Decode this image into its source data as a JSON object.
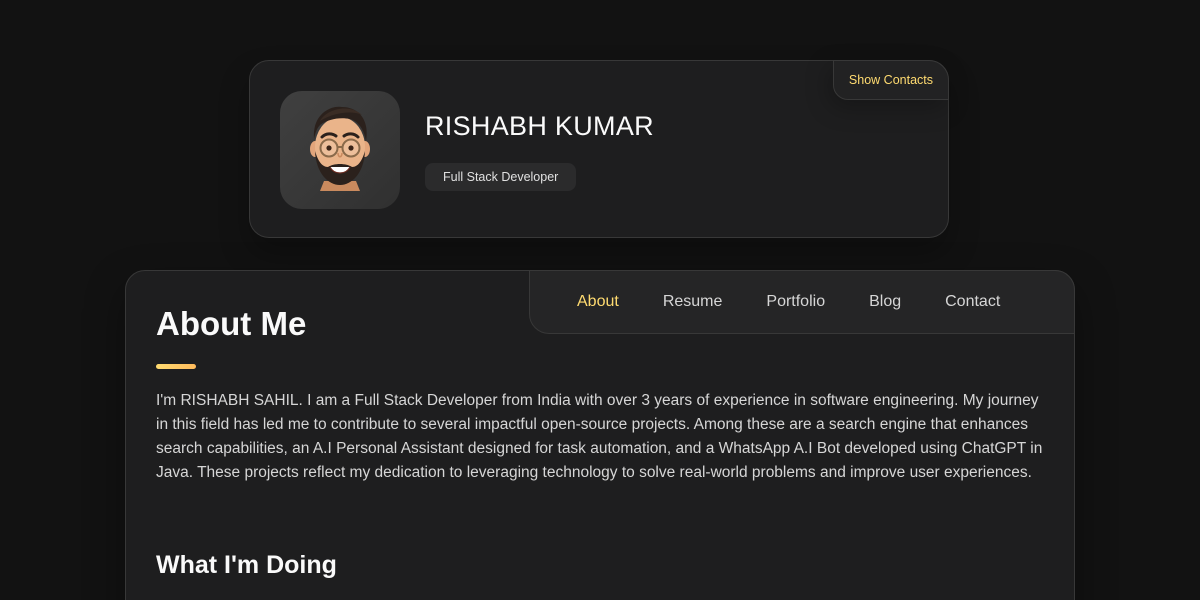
{
  "profile": {
    "name": "RISHABH KUMAR",
    "title": "Full Stack Developer",
    "show_contacts_label": "Show Contacts",
    "avatar_icon": "memoji-avatar-icon"
  },
  "navbar": {
    "items": [
      {
        "label": "About",
        "active": true
      },
      {
        "label": "Resume",
        "active": false
      },
      {
        "label": "Portfolio",
        "active": false
      },
      {
        "label": "Blog",
        "active": false
      },
      {
        "label": "Contact",
        "active": false
      }
    ]
  },
  "about": {
    "title": "About Me",
    "text": "I'm RISHABH SAHIL. I am a Full Stack Developer from India with over 3 years of experience in software engineering. My journey in this field has led me to contribute to several impactful open-source projects. Among these are a search engine that enhances search capabilities, an A.I Personal Assistant designed for task automation, and a WhatsApp A.I Bot developed using ChatGPT in Java. These projects reflect my dedication to leveraging technology to solve real-world problems and improve user experiences.",
    "service_title": "What I'm Doing"
  },
  "colors": {
    "background": "#121212",
    "card": "#1e1e1f",
    "accent": "#ffdb70",
    "text": "#d6d6d6",
    "heading": "#fafafa"
  }
}
